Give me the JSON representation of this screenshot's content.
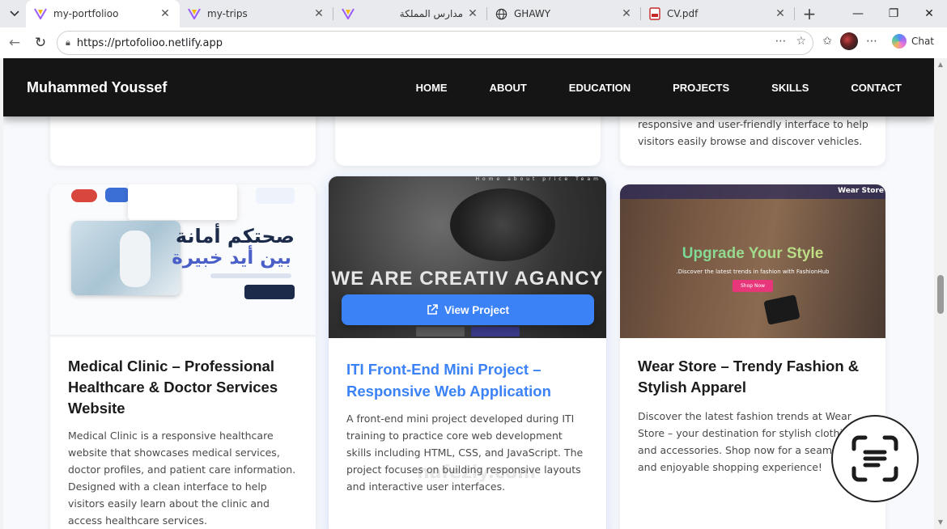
{
  "browser": {
    "tabs": [
      {
        "title": "my-portfolioo",
        "icon": "vite-icon",
        "active": true
      },
      {
        "title": "my-trips",
        "icon": "vite-icon",
        "active": false
      },
      {
        "title": "مدارس المملكة",
        "icon": "vite-icon",
        "active": false
      },
      {
        "title": "GHAWY",
        "icon": "globe-icon",
        "active": false
      },
      {
        "title": "CV.pdf",
        "icon": "pdf-icon",
        "active": false
      }
    ],
    "url": "https://prtofolioo.netlify.app",
    "chat_label": "Chat"
  },
  "site": {
    "brand": "Muhammed Youssef",
    "nav": [
      "HOME",
      "ABOUT",
      "EDUCATION",
      "PROJECTS",
      "SKILLS",
      "CONTACT"
    ]
  },
  "top_cards": {
    "right_text": "responsive and user-friendly interface to help visitors easily browse and discover vehicles."
  },
  "projects": [
    {
      "title": "Medical Clinic – Professional Healthcare & Doctor Services Website",
      "description": "Medical Clinic is a responsive healthcare website that showcases medical services, doctor profiles, and patient care information. Designed with a clean interface to help visitors easily learn about the clinic and access healthcare services.",
      "thumb_text_1": "صحتكم أمانة",
      "thumb_text_2": "بين أيد خبيرة"
    },
    {
      "title": "ITI Front-End Mini Project – Responsive Web Application",
      "description": "A front-end mini project developed during ITI training to practice core web development skills including HTML, CSS, and JavaScript. The project focuses on building responsive layouts and interactive user interfaces.",
      "thumb_heading": "WE ARE CREATIV AGANCY",
      "thumb_nav": "Home about price Team",
      "view_button": "View Project"
    },
    {
      "title": "Wear Store – Trendy Fashion & Stylish Apparel",
      "description": "Discover the latest fashion trends at Wear Store – your destination for stylish clothing and accessories. Shop now for a seamless and enjoyable shopping experience!",
      "thumb_logo": "Wear Store",
      "thumb_heading": "Upgrade Your Style",
      "thumb_sub": ".Discover the latest trends in fashion with FashionHub",
      "thumb_button": "Shop Now"
    }
  ],
  "watermark": "nafezly.com",
  "colors": {
    "accent": "#3b82f6",
    "navbar": "#151515"
  }
}
